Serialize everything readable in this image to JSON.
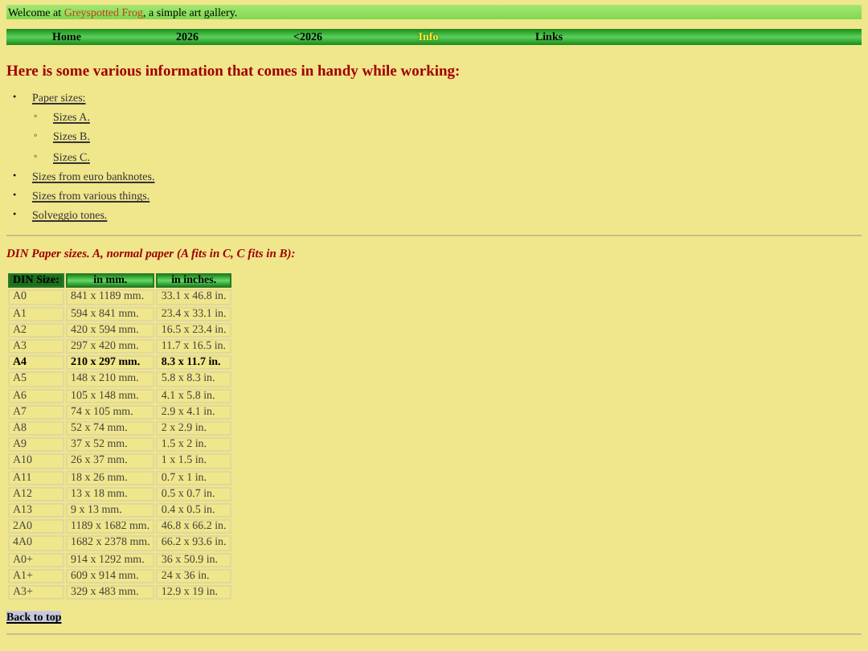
{
  "welcome": {
    "before": "Welcome at ",
    "link": "Greyspotted Frog",
    "after": ", a simple art gallery."
  },
  "nav": [
    {
      "label": "Home",
      "selected": false
    },
    {
      "label": "2026",
      "selected": false
    },
    {
      "label": "<2026",
      "selected": false
    },
    {
      "label": "Info",
      "selected": true
    },
    {
      "label": "Links",
      "selected": false
    }
  ],
  "heading": "Here is some various information that comes in handy while working:",
  "links": [
    {
      "marker": "•",
      "label": "Paper sizes:",
      "children": [
        {
          "marker": "◦",
          "label": "Sizes A."
        },
        {
          "marker": "◦",
          "label": "Sizes B."
        },
        {
          "marker": "◦",
          "label": "Sizes C."
        }
      ]
    },
    {
      "marker": "•",
      "label": "Sizes from euro banknotes."
    },
    {
      "marker": "•",
      "label": "Sizes from various things."
    },
    {
      "marker": "•",
      "label": "Solveggio tones."
    }
  ],
  "section_title": "DIN Paper sizes. A, normal paper (A fits in C, C fits in B):",
  "table": {
    "columns": [
      "DIN Size:",
      "in mm.",
      "in inches."
    ],
    "rows": [
      {
        "cells": [
          "A0",
          "841 x 1189 mm.",
          "33.1 x 46.8 in."
        ],
        "emphasized": false
      },
      {
        "cells": [
          "A1",
          "594 x 841 mm.",
          "23.4 x 33.1 in."
        ],
        "emphasized": false
      },
      {
        "cells": [
          "A2",
          "420 x 594 mm.",
          "16.5 x 23.4 in."
        ],
        "emphasized": false
      },
      {
        "cells": [
          "A3",
          "297 x 420 mm.",
          "11.7 x 16.5 in."
        ],
        "emphasized": false
      },
      {
        "cells": [
          "A4",
          "210 x 297 mm.",
          "8.3 x 11.7 in."
        ],
        "emphasized": true
      },
      {
        "cells": [
          "A5",
          "148 x 210 mm.",
          "5.8 x 8.3 in."
        ],
        "emphasized": false
      },
      {
        "cells": [
          "A6",
          "105 x 148 mm.",
          "4.1 x 5.8 in."
        ],
        "emphasized": false
      },
      {
        "cells": [
          "A7",
          "74 x 105 mm.",
          "2.9 x 4.1 in."
        ],
        "emphasized": false
      },
      {
        "cells": [
          "A8",
          "52 x 74 mm.",
          "2 x 2.9 in."
        ],
        "emphasized": false
      },
      {
        "cells": [
          "A9",
          "37 x 52 mm.",
          "1.5 x 2 in."
        ],
        "emphasized": false
      },
      {
        "cells": [
          "A10",
          "26 x 37 mm.",
          "1 x 1.5 in."
        ],
        "emphasized": false
      },
      {
        "cells": [
          "A11",
          "18 x 26 mm.",
          "0.7 x 1 in."
        ],
        "emphasized": false
      },
      {
        "cells": [
          "A12",
          "13 x 18 mm.",
          "0.5 x 0.7 in."
        ],
        "emphasized": false
      },
      {
        "cells": [
          "A13",
          "9 x 13 mm.",
          "0.4 x 0.5 in."
        ],
        "emphasized": false
      },
      {
        "cells": [
          "2A0",
          "1189 x 1682 mm.",
          "46.8 x 66.2 in."
        ],
        "emphasized": false
      },
      {
        "cells": [
          "4A0",
          "1682 x 2378 mm.",
          "66.2 x 93.6 in."
        ],
        "emphasized": false
      },
      {
        "cells": [
          "A0+",
          "914 x 1292 mm.",
          "36 x 50.9 in."
        ],
        "emphasized": false
      },
      {
        "cells": [
          "A1+",
          "609 x 914 mm.",
          "24 x 36 in."
        ],
        "emphasized": false
      },
      {
        "cells": [
          "A3+",
          "329 x 483 mm.",
          "12.9 x 19 in."
        ],
        "emphasized": false
      }
    ]
  },
  "back_link": "Back to top"
}
